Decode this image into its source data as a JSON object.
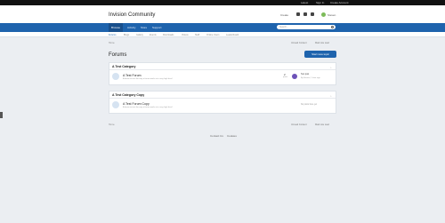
{
  "topbar": {
    "links": [
      "Latest",
      "Sign In",
      "Create Account"
    ]
  },
  "header": {
    "site_title": "Invision Community",
    "create_label": "Create",
    "user_label": "Steven"
  },
  "primary_nav": {
    "items": [
      "Browse",
      "Activity",
      "Store",
      "Support"
    ],
    "active": "Browse",
    "search_placeholder": "Search..."
  },
  "secondary_nav": {
    "items": [
      "Forums",
      "Blogs",
      "Gallery",
      "Events",
      "Downloads",
      "Videos",
      "Staff",
      "Online Users",
      "Leaderboard"
    ]
  },
  "breadcrumb": {
    "home": "Home",
    "mark_read": "Mark site read",
    "activity": "Unread Content"
  },
  "page": {
    "title": "Forums",
    "start_button": "Start new topic"
  },
  "categories": [
    {
      "name": "A Test Category",
      "forums": [
        {
          "title": "A Test Forum",
          "description": "A forum to test the way a forum works at a very high level",
          "posts_count": "2",
          "posts_label": "posts",
          "last_title": "Test post",
          "last_meta": "By Steven, 1 hour ago"
        }
      ]
    },
    {
      "name": "A Test Category Copy",
      "forums": [
        {
          "title": "A Test Forum Copy",
          "description": "A forum to test the way a forum works at a very high level",
          "no_posts": "No posts here yet"
        }
      ]
    }
  ],
  "footer": {
    "links": [
      "Contact Us",
      "Cookies"
    ]
  }
}
